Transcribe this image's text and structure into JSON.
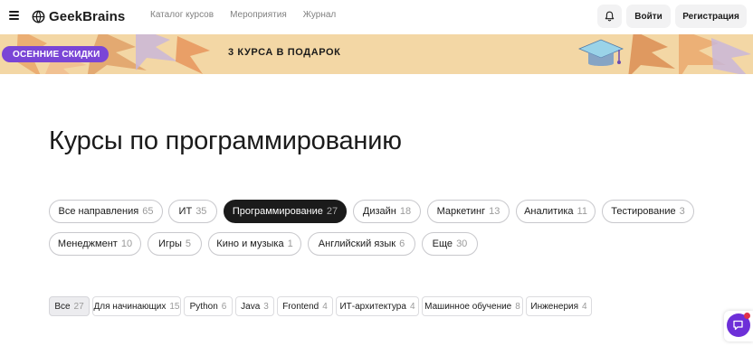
{
  "header": {
    "logo_text": "GeekBrains",
    "nav": [
      "Каталог курсов",
      "Мероприятия",
      "Журнал"
    ],
    "login_label": "Войти",
    "register_label": "Регистрация"
  },
  "banner": {
    "badge": "ОСЕННИЕ СКИДКИ",
    "title": "3 КУРСА В ПОДАРОК"
  },
  "page_title": "Курсы по программированию",
  "categories": [
    {
      "label": "Все направления",
      "count": "65"
    },
    {
      "label": "ИТ",
      "count": "35"
    },
    {
      "label": "Программирование",
      "count": "27"
    },
    {
      "label": "Дизайн",
      "count": "18"
    },
    {
      "label": "Маркетинг",
      "count": "13"
    },
    {
      "label": "Аналитика",
      "count": "11"
    },
    {
      "label": "Тестирование",
      "count": "3"
    },
    {
      "label": "Менеджмент",
      "count": "10"
    },
    {
      "label": "Игры",
      "count": "5"
    },
    {
      "label": "Кино и музыка",
      "count": "1"
    },
    {
      "label": "Английский язык",
      "count": "6"
    },
    {
      "label": "Еще",
      "count": "30"
    }
  ],
  "subcategories": [
    {
      "label": "Все",
      "count": "27"
    },
    {
      "label": "Для начинающих",
      "count": "15"
    },
    {
      "label": "Python",
      "count": "6"
    },
    {
      "label": "Java",
      "count": "3"
    },
    {
      "label": "Frontend",
      "count": "4"
    },
    {
      "label": "ИТ-архитектура",
      "count": "4"
    },
    {
      "label": "Машинное обучение",
      "count": "8"
    },
    {
      "label": "Инженерия",
      "count": "4"
    }
  ],
  "colors": {
    "accent": "#7a45d6",
    "banner_bg": "#f3d7a5",
    "active_chip": "#1b1b1b"
  },
  "icons": [
    "menu-icon",
    "geekbrains-logo-icon",
    "bell-icon",
    "chat-help-icon"
  ]
}
